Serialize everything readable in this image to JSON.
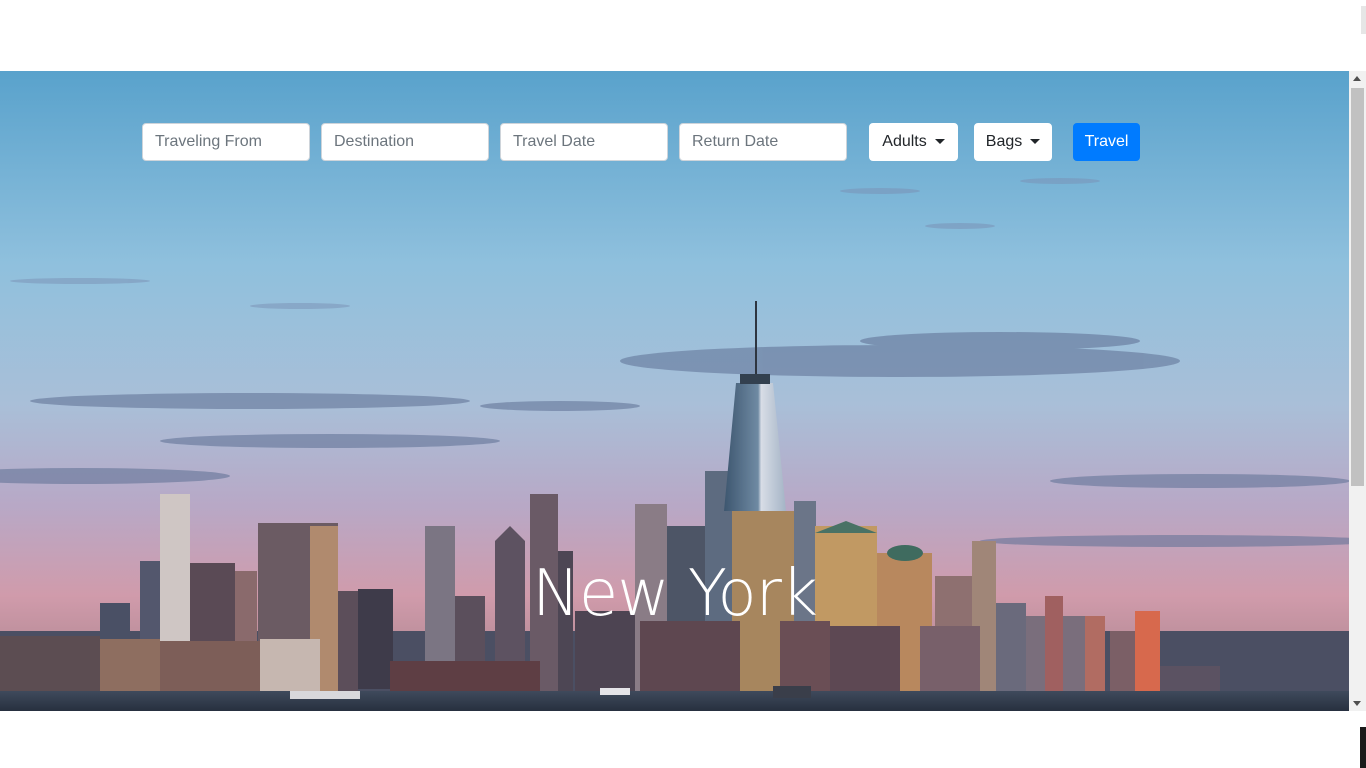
{
  "search": {
    "from_placeholder": "Traveling From",
    "destination_placeholder": "Destination",
    "travel_date_placeholder": "Travel Date",
    "return_date_placeholder": "Return Date",
    "adults_label": "Adults",
    "bags_label": "Bags",
    "travel_button": "Travel"
  },
  "hero": {
    "city": "New York"
  },
  "colors": {
    "primary_button": "#007bff",
    "sky_top": "#5aa3cc",
    "sky_bottom": "#d49aa8"
  },
  "icons": {
    "dropdown": "caret-down-icon",
    "scroll_up": "triangle-up-icon",
    "scroll_down": "triangle-down-icon"
  }
}
